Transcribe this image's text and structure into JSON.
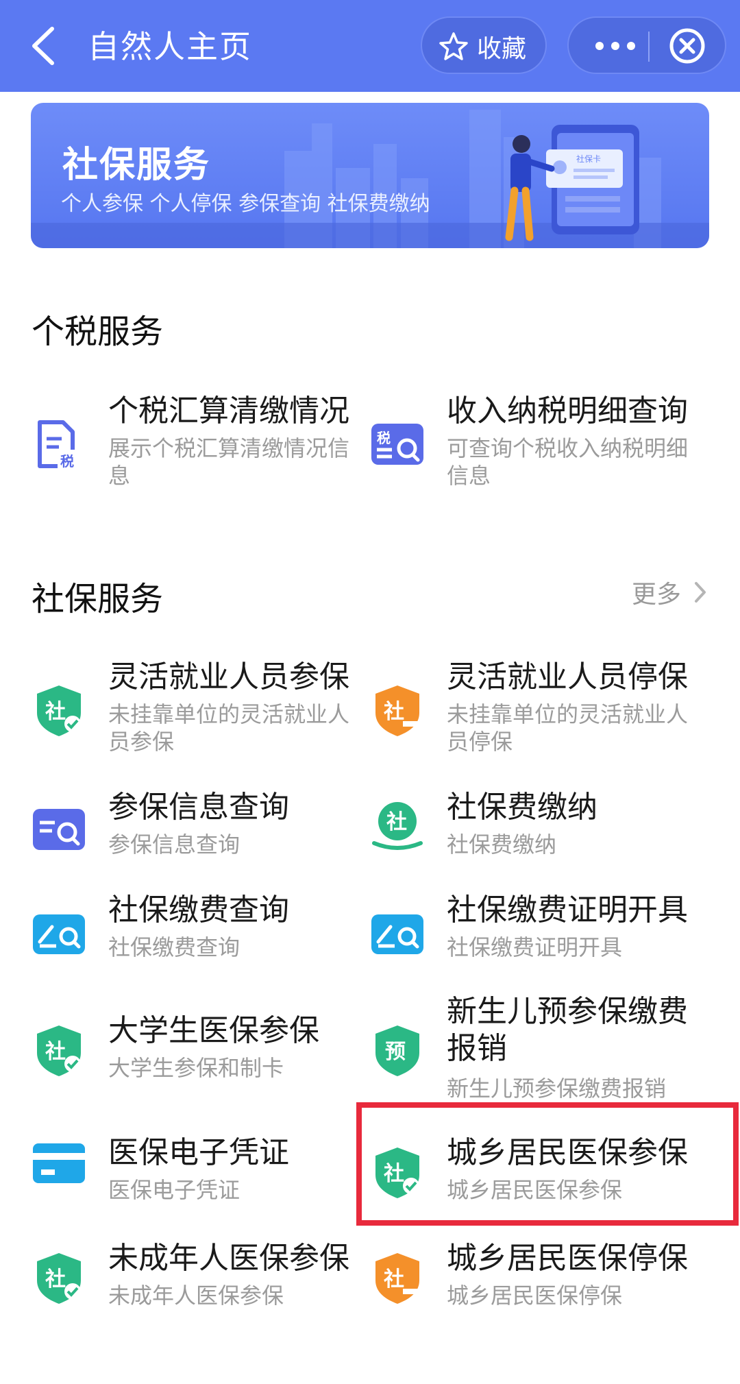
{
  "header": {
    "title": "自然人主页",
    "favorite_label": "收藏",
    "bg_color": "#5b79f2"
  },
  "banner": {
    "title": "社保服务",
    "subtitle": "个人参保 个人停保 参保查询 社保费缴纳",
    "card_text": "社保卡"
  },
  "tax_section": {
    "title": "个税服务",
    "items": [
      {
        "name": "个税汇算清缴情况",
        "desc": "展示个税汇算清缴情况信息",
        "icon": "document-tax-icon"
      },
      {
        "name": "收入纳税明细查询",
        "desc": "可查询个税收入纳税明细信息",
        "icon": "tax-search-icon"
      }
    ]
  },
  "social_section": {
    "title": "社保服务",
    "more_label": "更多",
    "items": [
      {
        "name": "灵活就业人员参保",
        "desc": "未挂靠单位的灵活就业人员参保",
        "icon": "shield-social-check-icon"
      },
      {
        "name": "灵活就业人员停保",
        "desc": "未挂靠单位的灵活就业人员停保",
        "icon": "shield-social-minus-icon"
      },
      {
        "name": "参保信息查询",
        "desc": "参保信息查询",
        "icon": "list-search-icon"
      },
      {
        "name": "社保费缴纳",
        "desc": "社保费缴纳",
        "icon": "social-pay-icon"
      },
      {
        "name": "社保缴费查询",
        "desc": "社保缴费查询",
        "icon": "pen-search-icon"
      },
      {
        "name": "社保缴费证明开具",
        "desc": "社保缴费证明开具",
        "icon": "pen-search-icon"
      },
      {
        "name": "大学生医保参保",
        "desc": "大学生参保和制卡",
        "icon": "shield-social-check-icon"
      },
      {
        "name": "新生儿预参保缴费报销",
        "name_line1": "新生儿预参保缴费",
        "name_line2": "报销",
        "desc": "新生儿预参保缴费报销",
        "icon": "shield-pre-icon",
        "icon_char": "预"
      },
      {
        "name": "医保电子凭证",
        "desc": "医保电子凭证",
        "icon": "card-icon"
      },
      {
        "name": "城乡居民医保参保",
        "desc": "城乡居民医保参保",
        "icon": "shield-social-check-icon"
      },
      {
        "name": "未成年人医保参保",
        "desc": "未成年人医保参保",
        "icon": "shield-social-check-icon"
      },
      {
        "name": "城乡居民医保停保",
        "desc": "城乡居民医保停保",
        "icon": "shield-social-minus-icon"
      }
    ]
  },
  "icon_chars": {
    "social": "社",
    "tax": "税"
  },
  "colors": {
    "green": "#2bb885",
    "orange": "#f4902a",
    "blue": "#5a6be8",
    "cyan": "#1fa7e8",
    "highlight": "#e82a3c"
  }
}
